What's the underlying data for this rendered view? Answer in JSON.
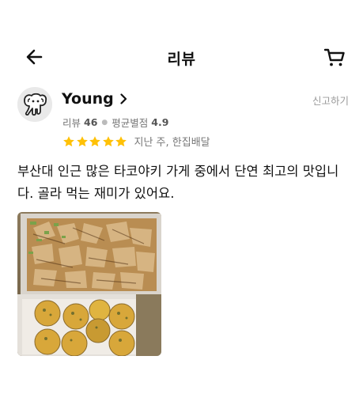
{
  "header": {
    "title": "리뷰",
    "back_icon": "arrow-left-icon",
    "cart_icon": "cart-icon"
  },
  "review": {
    "user": {
      "name": "Young",
      "avatar_icon": "elephant-icon",
      "review_count_label": "리뷰",
      "review_count": "46",
      "avg_rating_label": "평균별점",
      "avg_rating": "4.9"
    },
    "report_label": "신고하기",
    "rating": 5,
    "star_color": "#FFC107",
    "info": "지난 주, 한집배달",
    "text": "부산대 인근 많은 타코야키 가게 중에서 단연 최고의 맛입니다. 골라 먹는 재미가 있어요.",
    "photo_icon": "takoyaki-photo"
  }
}
